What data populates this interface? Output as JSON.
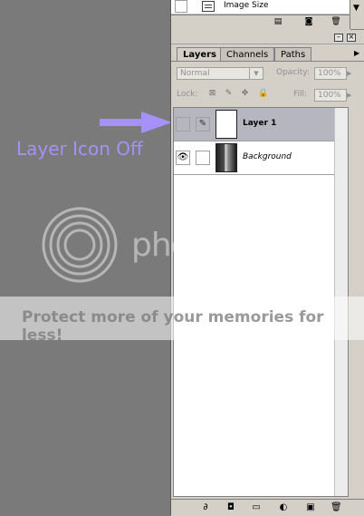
{
  "history": {
    "item_label": "Image Size",
    "scroll_arrow": "▼",
    "toolbar": [
      "▤",
      "◙",
      "🗑"
    ]
  },
  "palette": {
    "minimize": "–",
    "close": "×",
    "menu_arrow": "▶",
    "tabs": [
      "Layers",
      "Channels",
      "Paths"
    ],
    "blend_mode": "Normal",
    "blend_dd": "▼",
    "opacity_label": "Opacity:",
    "opacity_value": "100%",
    "opacity_dd": "▶",
    "lock_label": "Lock:",
    "fill_label": "Fill:",
    "fill_value": "100%",
    "fill_dd": "▶",
    "lock_icons": [
      "⊠",
      "✎",
      "✥",
      "🔒"
    ]
  },
  "layers": [
    {
      "name": "Layer 1",
      "visible": false,
      "selected": true,
      "link_glyph": "✎",
      "locked": false
    },
    {
      "name": "Background",
      "visible": true,
      "selected": false,
      "link_glyph": "",
      "locked": true
    }
  ],
  "eye_glyph": "👁",
  "lock_glyph": "🔒",
  "bottom_toolbar": [
    "∂",
    "◘",
    "▭",
    "◐",
    "▣",
    "🗑"
  ],
  "annotation": {
    "label": "Layer Icon Off",
    "color": "#a691f8"
  },
  "watermark": {
    "brand": "photobucket",
    "tagline": "Protect more of your memories for less!"
  }
}
